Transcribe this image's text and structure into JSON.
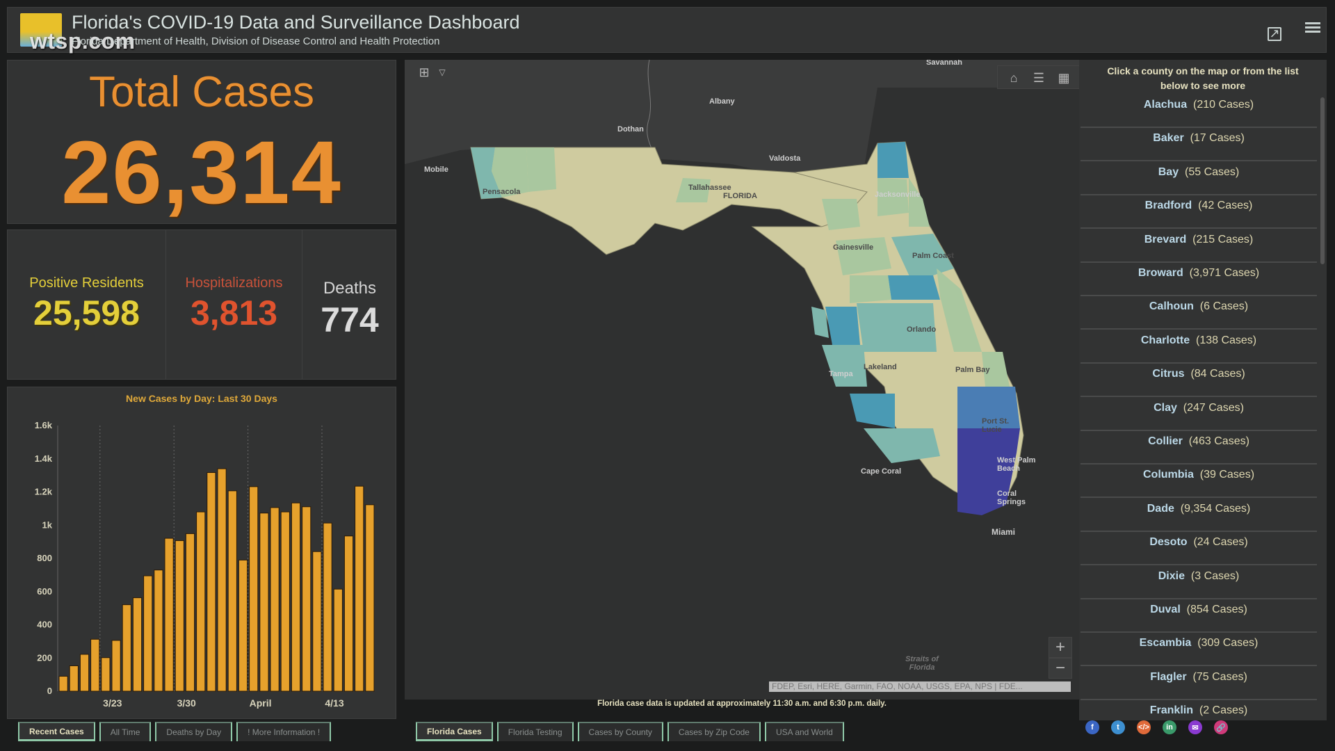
{
  "header": {
    "title": "Florida's COVID-19 Data and Surveillance Dashboard",
    "subtitle": "Florida Department of Health, Division of Disease Control and Health Protection",
    "watermark": "wtsp.com",
    "icons": [
      "external-link-icon",
      "hamburger-menu-icon"
    ]
  },
  "totals": {
    "label": "Total Cases",
    "value": "26,314",
    "color": "#e99032"
  },
  "stats": [
    {
      "label": "Positive Residents",
      "value": "25,598",
      "color": "#e4cf3a"
    },
    {
      "label": "Hospitalizations",
      "value": "3,813",
      "color": "#e0532e"
    },
    {
      "label": "Deaths",
      "value": "774",
      "color": "#dcdcdc"
    }
  ],
  "chart_data": {
    "type": "bar",
    "title": "New Cases by Day: Last 30 Days",
    "xlabel": "",
    "ylabel": "",
    "ylim": [
      0,
      1600
    ],
    "yticks": [
      0,
      200,
      400,
      600,
      800,
      1000,
      1200,
      1400,
      1600
    ],
    "ytick_labels": [
      "0",
      "200",
      "400",
      "600",
      "800",
      "1k",
      "1.2k",
      "1.4k",
      "1.6k"
    ],
    "xtick_labels": [
      {
        "label": "3/23",
        "index": 4
      },
      {
        "label": "3/30",
        "index": 11
      },
      {
        "label": "April",
        "index": 18
      },
      {
        "label": "4/13",
        "index": 25
      }
    ],
    "grid": "vertical-dotted",
    "bar_color": "#e6a12c",
    "values": [
      90,
      153,
      222,
      313,
      202,
      306,
      521,
      563,
      695,
      730,
      921,
      907,
      949,
      1080,
      1317,
      1340,
      1207,
      790,
      1232,
      1073,
      1106,
      1080,
      1134,
      1111,
      841,
      1013,
      615,
      935,
      1235,
      1123
    ]
  },
  "left_tabs": [
    {
      "label": "Recent Cases",
      "active": true
    },
    {
      "label": "All Time",
      "active": false
    },
    {
      "label": "Deaths by Day",
      "active": false
    },
    {
      "label": "! More Information !",
      "active": false
    }
  ],
  "map": {
    "note": "Florida case data is updated at approximately 11:30 a.m. and 6:30 p.m. daily.",
    "attribution": "FDEP, Esri, HERE, Garmin, FAO, NOAA, USGS, EPA, NPS | FDE...",
    "zoom_in": "+",
    "zoom_out": "−",
    "places": [
      {
        "name": "Savannah"
      },
      {
        "name": "Albany"
      },
      {
        "name": "Dothan"
      },
      {
        "name": "Valdosta"
      },
      {
        "name": "Mobile"
      },
      {
        "name": "Pensacola"
      },
      {
        "name": "Tallahassee"
      },
      {
        "name": "FLORIDA"
      },
      {
        "name": "Jacksonville"
      },
      {
        "name": "Gainesville"
      },
      {
        "name": "Palm Coast"
      },
      {
        "name": "Orlando"
      },
      {
        "name": "Palm Bay"
      },
      {
        "name": "Tampa"
      },
      {
        "name": "Lakeland"
      },
      {
        "name": "Port St. Lucie"
      },
      {
        "name": "Cape Coral"
      },
      {
        "name": "West Palm Beach"
      },
      {
        "name": "Coral Springs"
      },
      {
        "name": "Miami"
      },
      {
        "name": "Straits of Florida"
      }
    ],
    "choropleth_colors": [
      "#cfcb9f",
      "#a9c79f",
      "#7fb7ad",
      "#4a9ab4",
      "#4a7db4",
      "#3f3f9a"
    ]
  },
  "map_tabs": [
    {
      "label": "Florida Cases",
      "active": true
    },
    {
      "label": "Florida Testing",
      "active": false
    },
    {
      "label": "Cases by County",
      "active": false
    },
    {
      "label": "Cases by Zip Code",
      "active": false
    },
    {
      "label": "USA and World",
      "active": false
    }
  ],
  "county_list": {
    "header": "Click a county on the map or from the list below to see more",
    "items": [
      {
        "name": "Alachua",
        "cases": "(210 Cases)"
      },
      {
        "name": "Baker",
        "cases": "(17 Cases)"
      },
      {
        "name": "Bay",
        "cases": "(55 Cases)"
      },
      {
        "name": "Bradford",
        "cases": "(42 Cases)"
      },
      {
        "name": "Brevard",
        "cases": "(215 Cases)"
      },
      {
        "name": "Broward",
        "cases": "(3,971 Cases)"
      },
      {
        "name": "Calhoun",
        "cases": "(6 Cases)"
      },
      {
        "name": "Charlotte",
        "cases": "(138 Cases)"
      },
      {
        "name": "Citrus",
        "cases": "(84 Cases)"
      },
      {
        "name": "Clay",
        "cases": "(247 Cases)"
      },
      {
        "name": "Collier",
        "cases": "(463 Cases)"
      },
      {
        "name": "Columbia",
        "cases": "(39 Cases)"
      },
      {
        "name": "Dade",
        "cases": "(9,354 Cases)"
      },
      {
        "name": "Desoto",
        "cases": "(24 Cases)"
      },
      {
        "name": "Dixie",
        "cases": "(3 Cases)"
      },
      {
        "name": "Duval",
        "cases": "(854 Cases)"
      },
      {
        "name": "Escambia",
        "cases": "(309 Cases)"
      },
      {
        "name": "Flagler",
        "cases": "(75 Cases)"
      },
      {
        "name": "Franklin",
        "cases": "(2 Cases)"
      }
    ]
  },
  "share": [
    {
      "name": "facebook",
      "glyph": "f",
      "color": "#3b66c4"
    },
    {
      "name": "twitter",
      "glyph": "t",
      "color": "#3d8fd0"
    },
    {
      "name": "embed",
      "glyph": "</>",
      "color": "#e06a3a"
    },
    {
      "name": "linkedin",
      "glyph": "in",
      "color": "#3a9a6a"
    },
    {
      "name": "email",
      "glyph": "✉",
      "color": "#8a3ad0"
    },
    {
      "name": "link",
      "glyph": "🔗",
      "color": "#d03a7a"
    }
  ]
}
